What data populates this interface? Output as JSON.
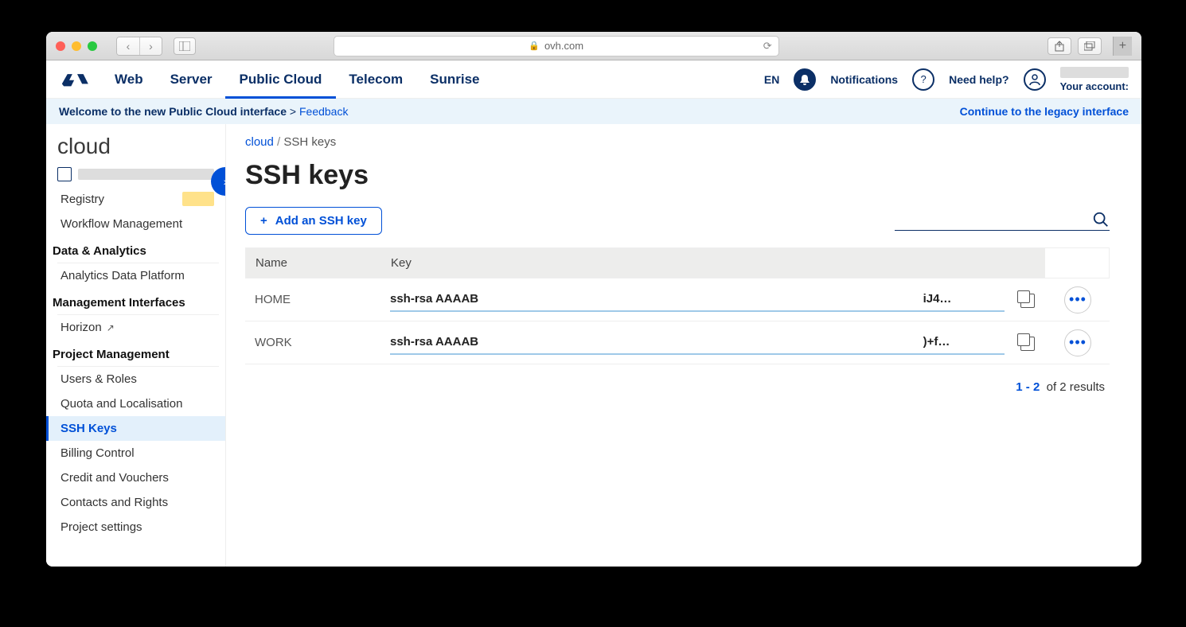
{
  "browser": {
    "url_host": "ovh.com"
  },
  "topnav": {
    "tabs": [
      "Web",
      "Server",
      "Public Cloud",
      "Telecom",
      "Sunrise"
    ],
    "active_tab": "Public Cloud",
    "lang": "EN",
    "notifications": "Notifications",
    "help": "Need help?",
    "account_label": "Your account:"
  },
  "banner": {
    "welcome": "Welcome to the new Public Cloud interface",
    "feedback": "Feedback",
    "legacy": "Continue to the legacy interface"
  },
  "sidebar": {
    "project_title": "cloud",
    "items": [
      {
        "label": "Registry",
        "badge": true
      },
      {
        "label": "Workflow Management"
      }
    ],
    "section_data": "Data & Analytics",
    "data_items": [
      {
        "label": "Analytics Data Platform"
      }
    ],
    "section_mgmt": "Management Interfaces",
    "mgmt_items": [
      {
        "label": "Horizon",
        "external": true
      }
    ],
    "section_proj": "Project Management",
    "proj_items": [
      {
        "label": "Users & Roles"
      },
      {
        "label": "Quota and Localisation"
      },
      {
        "label": "SSH Keys",
        "selected": true
      },
      {
        "label": "Billing Control"
      },
      {
        "label": "Credit and Vouchers"
      },
      {
        "label": "Contacts and Rights"
      },
      {
        "label": "Project settings"
      }
    ]
  },
  "breadcrumb": {
    "root": "cloud",
    "current": "SSH keys"
  },
  "page": {
    "title": "SSH keys",
    "add_button": "Add an SSH key"
  },
  "table": {
    "col_name": "Name",
    "col_key": "Key",
    "rows": [
      {
        "name": "HOME",
        "key": "ssh-rsa AAAAB                                                                                                                                      iJ4…"
      },
      {
        "name": "WORK",
        "key": "ssh-rsa AAAAB                                                                                                                                      )+f…"
      }
    ]
  },
  "pager": {
    "range": "1 - 2",
    "total_text": "of 2 results"
  }
}
